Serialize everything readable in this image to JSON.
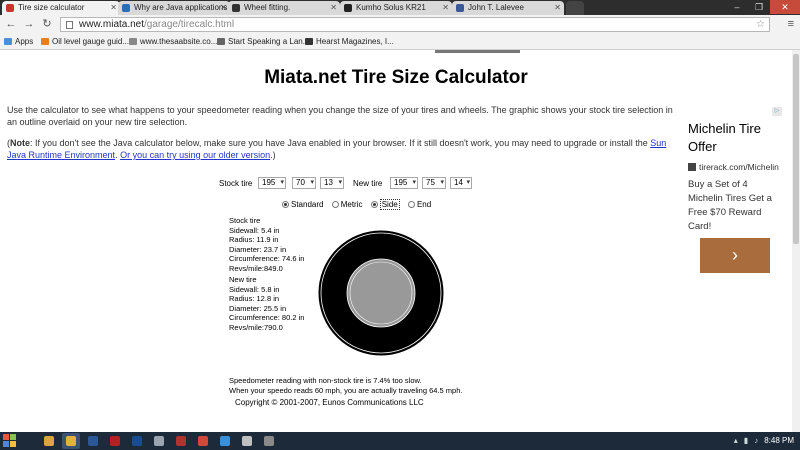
{
  "browser": {
    "tabs": [
      {
        "label": "Tire size calculator",
        "active": true,
        "favicon_color": "#c0392b"
      },
      {
        "label": "Why are Java applications",
        "active": false,
        "favicon_color": "#2a6ebb"
      },
      {
        "label": "Wheel fitting.",
        "active": false,
        "favicon_color": "#333333"
      },
      {
        "label": "Kumho Solus KR21",
        "active": false,
        "favicon_color": "#222222"
      },
      {
        "label": "John T. Lalevee",
        "active": false,
        "favicon_color": "#3b5998"
      }
    ],
    "url_host": "www.miata.net",
    "url_path": "/garage/tirecalc.html",
    "bookmarks": [
      {
        "label": "Apps",
        "icon_color": "#4a90d9"
      },
      {
        "label": "Oil level gauge guid...",
        "icon_color": "#e67e22"
      },
      {
        "label": "www.thesaabsite.co...",
        "icon_color": "#888888"
      },
      {
        "label": "Start Speaking a Lan...",
        "icon_color": "#666666"
      },
      {
        "label": "Hearst Magazines, I...",
        "icon_color": "#333333"
      }
    ]
  },
  "page": {
    "title": "Miata.net Tire Size Calculator",
    "intro": "Use the calculator to see what happens to your speedometer reading when you change the size of your tires and wheels. The graphic shows your stock tire selection in an outline overlaid on your new tire selection.",
    "note_label": "Note",
    "note_text": ": If you don't see the Java calculator below, make sure you have Java enabled in your browser. If it still doesn't work, you may need to upgrade or install the ",
    "note_link1": "Sun Java Runtime Environment",
    "note_mid": ". ",
    "note_link2": "Or you can try using our older version",
    "note_end": ".)",
    "note_open": "(",
    "calculator": {
      "stock_label": "Stock tire",
      "stock_width": "195",
      "stock_aspect": "70",
      "stock_rim": "13",
      "new_label": "New tire",
      "new_width": "195",
      "new_aspect": "75",
      "new_rim": "14",
      "units": [
        {
          "label": "Standard",
          "checked": true
        },
        {
          "label": "Metric",
          "checked": false
        },
        {
          "label": "Side",
          "checked": true
        },
        {
          "label": "End",
          "checked": false
        }
      ],
      "stock_stats": {
        "heading": "Stock tire",
        "sidewall": "Sidewall: 5.4 in",
        "radius": "Radius: 11.9 in",
        "diameter": "Diameter: 23.7 in",
        "circumference": "Circumference: 74.6 in",
        "revs": "Revs/mile:849.0"
      },
      "new_stats": {
        "heading": "New tire",
        "sidewall": "Sidewall: 5.8 in",
        "radius": "Radius: 12.8 in",
        "diameter": "Diameter: 25.5 in",
        "circumference": "Circumference: 80.2 in",
        "revs": "Revs/mile:790.0"
      },
      "speedo_line1": "Speedometer reading with non-stock tire is 7.4% too slow.",
      "speedo_line2": "When your speedo reads 60 mph, you are actually traveling 64.5 mph."
    },
    "copyright": "Copyright © 2001-2007, Eunos Communications LLC"
  },
  "ad": {
    "headline": "Michelin Tire Offer",
    "url": "tirerack.com/Michelin",
    "description": "Buy a Set of 4 Michelin Tires Get a Free $70 Reward Card!",
    "cta": "›",
    "cta_color": "#a86c3d"
  },
  "taskbar": {
    "clock": "8:48 PM",
    "apps": [
      {
        "name": "file-explorer",
        "color": "#d9a441",
        "active": false
      },
      {
        "name": "chrome",
        "color": "#e2b33c",
        "active": true
      },
      {
        "name": "word",
        "color": "#2b5797",
        "active": false
      },
      {
        "name": "acrobat",
        "color": "#b22222",
        "active": false
      },
      {
        "name": "photoshop",
        "color": "#1a4d8f",
        "active": false
      },
      {
        "name": "app-6",
        "color": "#9aa5b1",
        "active": false
      },
      {
        "name": "filezilla",
        "color": "#b0332f",
        "active": false
      },
      {
        "name": "app-8",
        "color": "#d04a3a",
        "active": false
      },
      {
        "name": "internet-explorer",
        "color": "#3a8fd6",
        "active": false
      },
      {
        "name": "app-10",
        "color": "#c0c0c0",
        "active": false
      },
      {
        "name": "app-11",
        "color": "#8a8a8a",
        "active": false
      }
    ]
  }
}
